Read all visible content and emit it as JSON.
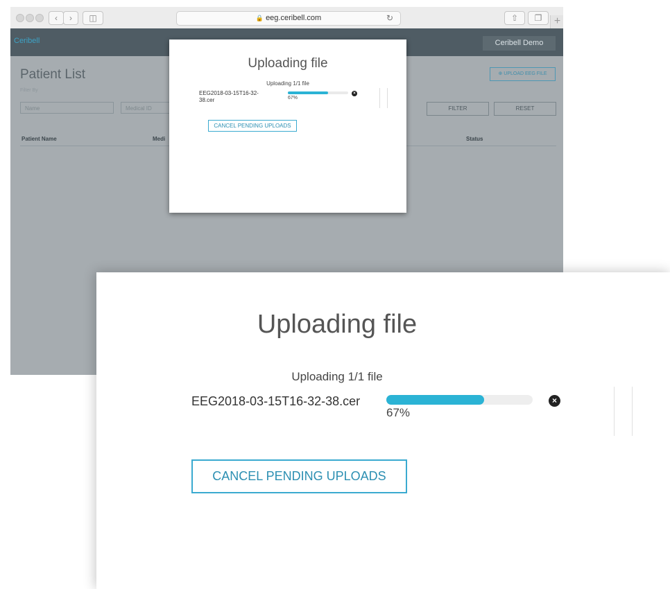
{
  "browser": {
    "url": "eeg.ceribell.com",
    "icons": [
      "back-icon",
      "forward-icon",
      "sidebar-icon",
      "lock-icon",
      "reload-icon",
      "share-icon",
      "tabs-icon",
      "new-tab-icon"
    ]
  },
  "app": {
    "brand": "Ceribell",
    "user_button": "Ceribell Demo",
    "page_title": "Patient List",
    "filter_label": "Filter By",
    "upload_button": "UPLOAD EEG FILE",
    "name_placeholder": "Name",
    "medical_id_placeholder": "Medical ID",
    "filter_button": "FILTER",
    "reset_button": "RESET",
    "table_headers": {
      "patient_name": "Patient Name",
      "medical_id_partial": "Medi",
      "status": "Status"
    }
  },
  "upload_modal": {
    "title": "Uploading file",
    "status": "Uploading 1/1 file",
    "file_name": "EEG2018-03-15T16-32-38.cer",
    "progress_label": "67%",
    "progress_fraction": 0.67,
    "cancel_button": "CANCEL PENDING UPLOADS"
  },
  "colors": {
    "accent": "#2bb3d5",
    "navbar": "#4f5c64",
    "overlay": "#a6acb0"
  }
}
